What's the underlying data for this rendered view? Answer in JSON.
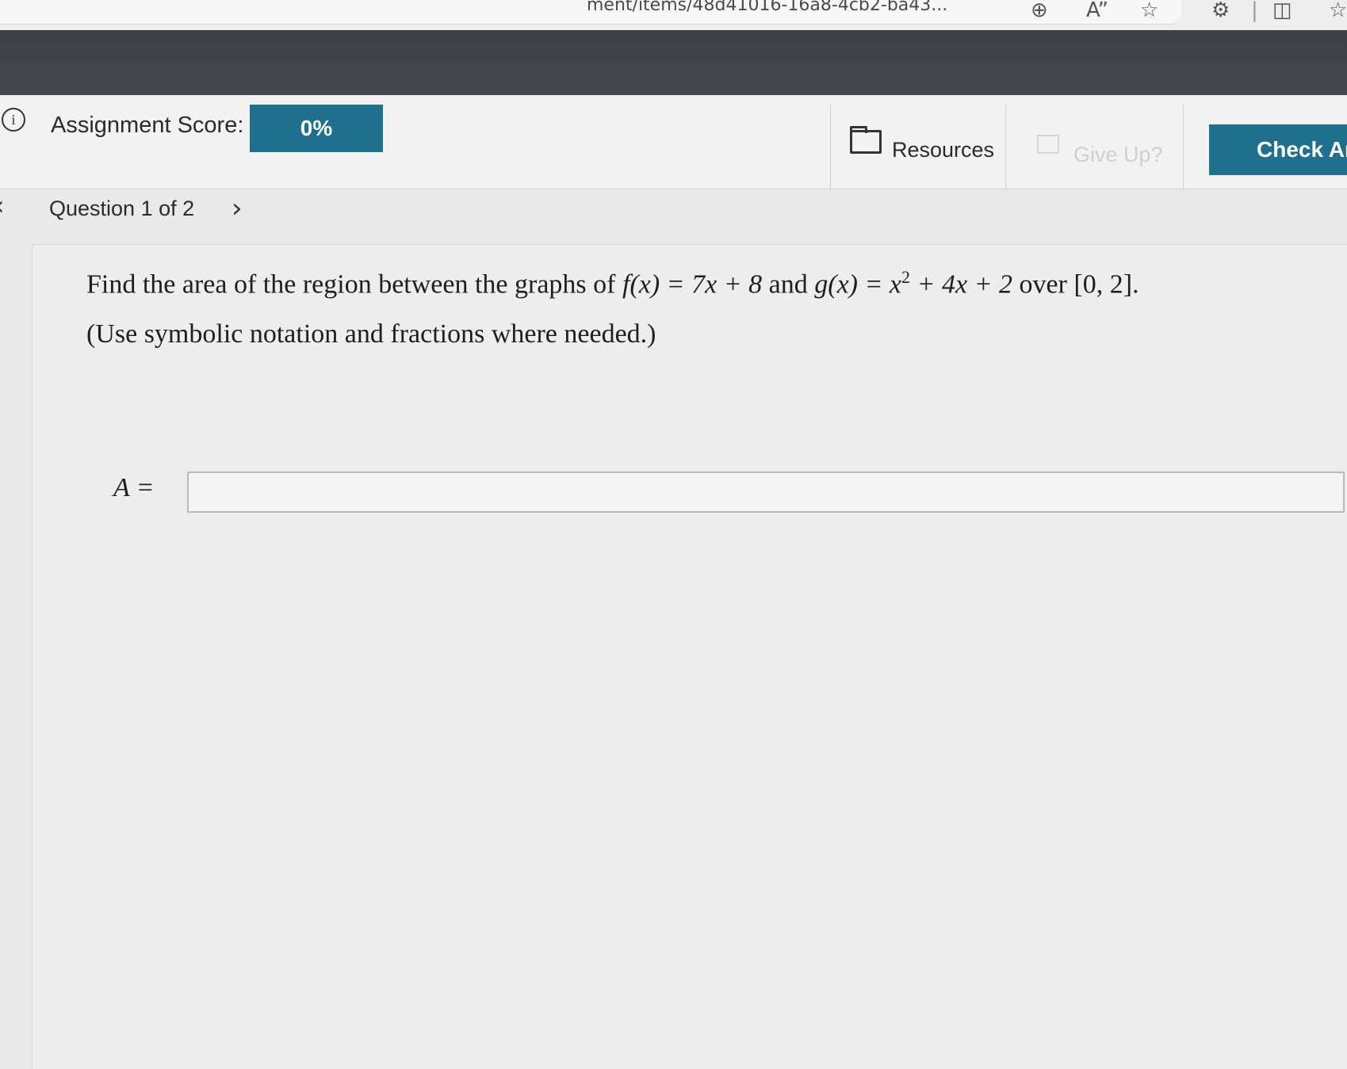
{
  "browser": {
    "url_fragment": "ment/items/48d41016-16a8-4cb2-ba43...",
    "icons": [
      "zoom-in-icon",
      "read-aloud-icon",
      "favorite-star-icon",
      "extensions-icon",
      "split-screen-icon",
      "favorites-icon"
    ]
  },
  "header": {
    "score_label": "Assignment Score:",
    "score_value": "0%",
    "resources_label": "Resources",
    "give_up_label": "Give Up?",
    "check_answer_label": "Check Answer"
  },
  "nav": {
    "question_label": "Question 1 of 2"
  },
  "problem": {
    "prefix": "Find the area of the region between the graphs of ",
    "f_expr": "f(x) = 7x + 8",
    "mid": " and ",
    "g_expr_left": "g(x) = x",
    "g_exponent": "2",
    "g_expr_right": " + 4x + 2",
    "over": " over ",
    "interval": "[0, 2].",
    "instructions": "(Use symbolic notation and fractions where needed.)"
  },
  "answer": {
    "label": "A =",
    "value": ""
  },
  "colors": {
    "accent": "#1f6f8f"
  }
}
